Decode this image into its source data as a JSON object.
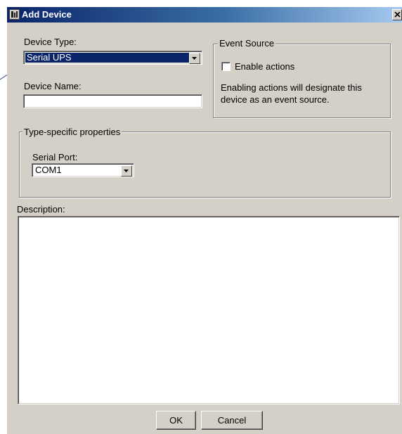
{
  "window": {
    "title": "Add Device"
  },
  "device_type": {
    "label": "Device Type:",
    "value": "Serial UPS"
  },
  "device_name": {
    "label": "Device Name:",
    "value": ""
  },
  "event_source": {
    "legend": "Event Source",
    "checkbox_label": "Enable actions",
    "checked": false,
    "note_line1": "Enabling actions will designate this",
    "note_line2": "device as an event source."
  },
  "type_specific": {
    "legend": "Type-specific properties",
    "serial_port_label": "Serial Port:",
    "serial_port_value": "COM1"
  },
  "description": {
    "label": "Description:",
    "value": ""
  },
  "buttons": {
    "ok": "OK",
    "cancel": "Cancel"
  },
  "icons": {
    "window_icon": "app-icon",
    "close": "close-icon",
    "dropdown": "chevron-down-icon"
  }
}
